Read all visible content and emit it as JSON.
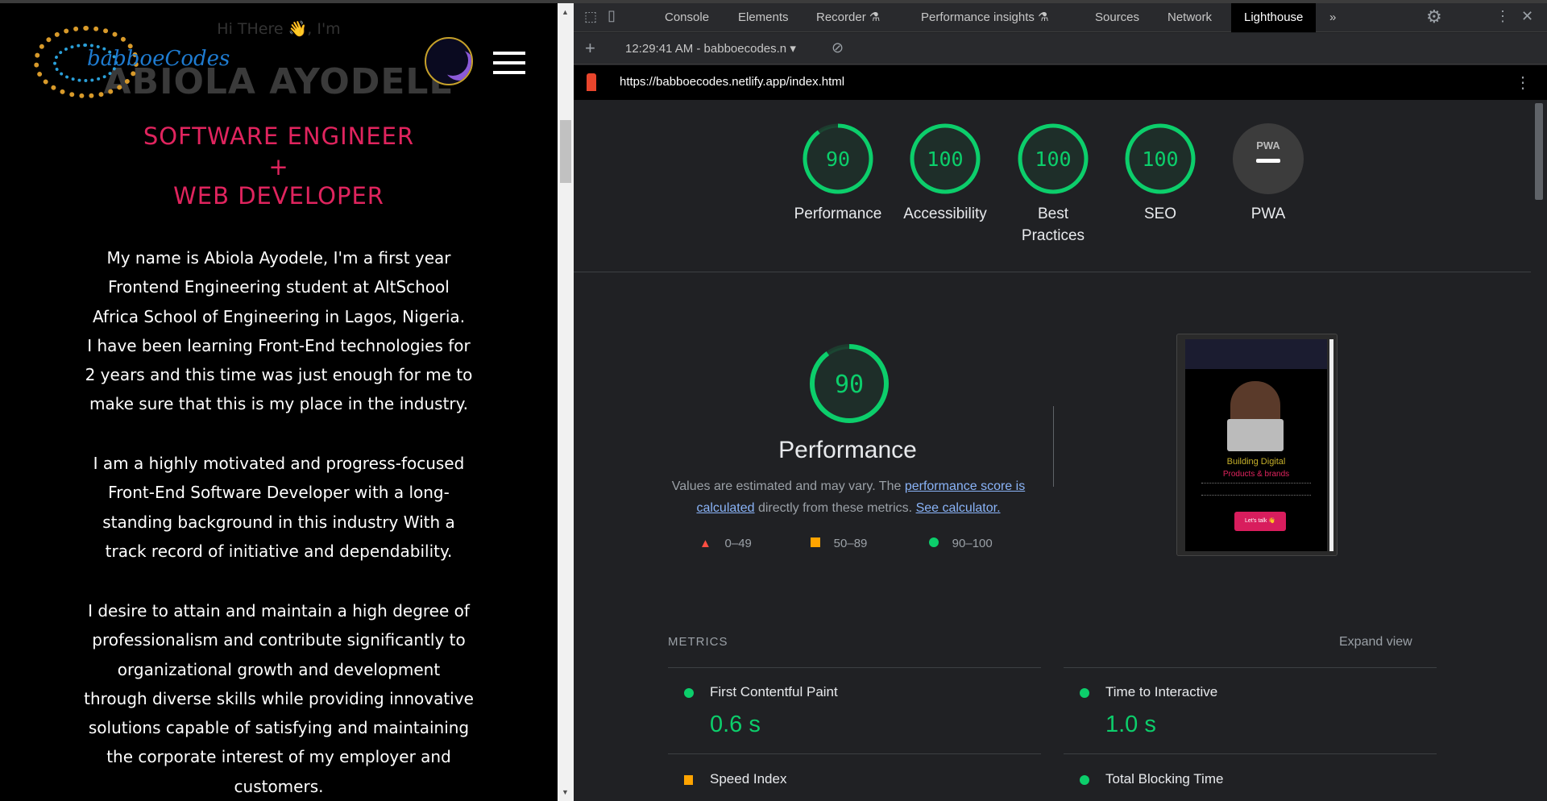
{
  "page": {
    "greeting": "Hi THere 👋, I'm",
    "name": "ABIOLA AYODELE",
    "logo_text": "babboeCodes",
    "role_1": "SOFTWARE ENGINEER",
    "role_plus": "+",
    "role_2": "WEB DEVELOPER",
    "paragraphs": [
      [
        "My name is Abiola Ayodele, I'm a first year",
        "Frontend Engineering student at AltSchool",
        "Africa School of Engineering in Lagos, Nigeria.",
        "I have been learning Front-End technologies for",
        "2 years and this time was just enough for me to",
        "make sure that this is my place in the industry."
      ],
      [
        "I am a highly motivated and progress-focused",
        "Front-End Software Developer with a long-",
        "standing background in this industry With a",
        "track record of initiative and dependability."
      ],
      [
        "I desire to attain and maintain a high degree of",
        "professionalism and contribute significantly to",
        "organizational growth and development",
        "through diverse skills while providing innovative",
        "solutions capable of satisfying and maintaining",
        "the corporate interest of my employer and",
        "customers."
      ]
    ]
  },
  "devtools": {
    "tabs": [
      "Console",
      "Elements",
      "Recorder",
      "Performance insights",
      "Sources",
      "Network",
      "Lighthouse"
    ],
    "active_tab": "Lighthouse",
    "more_tabs": "»",
    "report_selector": "12:29:41 AM - babboecodes.n",
    "url": "https://babboecodes.netlify.app/index.html"
  },
  "lighthouse": {
    "scores": [
      {
        "label": "Performance",
        "value": 90
      },
      {
        "label": "Accessibility",
        "value": 100
      },
      {
        "label": "Best Practices",
        "value": 100
      },
      {
        "label": "SEO",
        "value": 100
      }
    ],
    "pwa_label": "PWA",
    "pwa_badge": "PWA",
    "performance": {
      "score": 90,
      "title": "Performance",
      "desc_1": "Values are estimated and may vary. The ",
      "link_1": "performance score is calculated",
      "desc_2": " directly from these metrics. ",
      "link_2": "See calculator.",
      "legend": [
        "0–49",
        "50–89",
        "90–100"
      ]
    },
    "thumbnail": {
      "heading_1": "Building Digital",
      "heading_2": "Products & brands",
      "cta": "Let's talk 👋"
    },
    "metrics_header": "METRICS",
    "expand_view": "Expand view",
    "metrics": [
      {
        "label": "First Contentful Paint",
        "value": "0.6 s",
        "status": "pass"
      },
      {
        "label": "Time to Interactive",
        "value": "1.0 s",
        "status": "pass"
      },
      {
        "label": "Speed Index",
        "status": "average"
      },
      {
        "label": "Total Blocking Time",
        "status": "pass"
      }
    ],
    "colors": {
      "pass": "#0cce6b",
      "average": "#ffa400",
      "fail": "#ff4e42"
    }
  }
}
